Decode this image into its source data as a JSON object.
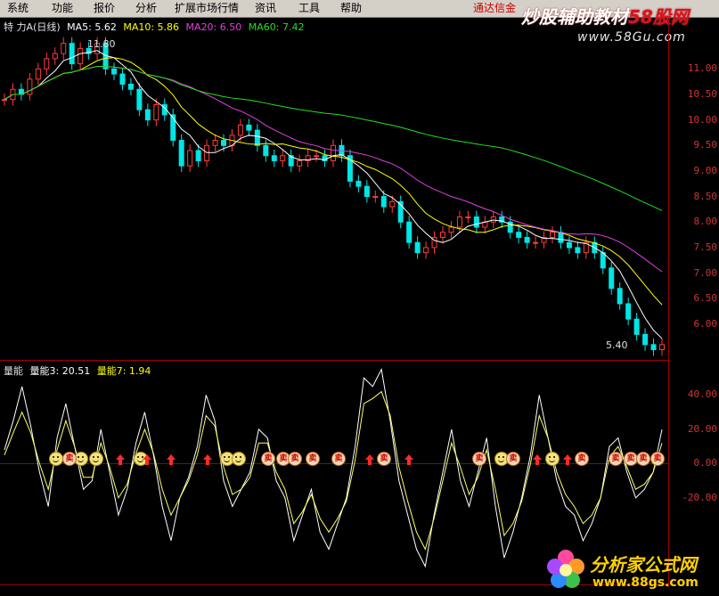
{
  "menu": {
    "items": [
      "系统",
      "功能",
      "报价",
      "分析",
      "扩展市场行情",
      "资讯",
      "工具",
      "帮助"
    ],
    "broker": "通达信金"
  },
  "watermark": {
    "brand_white": "炒股辅助教材",
    "brand_red": "58股网",
    "url": "www.58Gu.com",
    "bottom_title": "分析家公式网",
    "bottom_url": "www.88gs.com"
  },
  "price_panel": {
    "title": "特 力A(日线)",
    "ma5_label": "MA5: 5.62",
    "ma10_label": "MA10: 5.86",
    "ma20_label": "MA20: 6.50",
    "ma60_label": "MA60: 7.42",
    "high_note": "11.80",
    "low_note": "5.40",
    "ticks": [
      "11.00",
      "10.50",
      "10.00",
      "9.50",
      "9.00",
      "8.50",
      "8.00",
      "7.50",
      "7.00",
      "6.50",
      "6.00"
    ]
  },
  "volume_panel": {
    "title": "量能",
    "l1": "量能3: 20.51",
    "l2": "量能7: 1.94",
    "ticks": [
      "40.00",
      "20.00",
      "0.00",
      "-20.00"
    ]
  },
  "colors": {
    "ma5": "#ffffff",
    "ma10": "#ffff00",
    "ma20": "#e040e0",
    "ma60": "#20e020",
    "up": "#ff3c3c",
    "down": "#00e5e5",
    "axis": "#d23434"
  },
  "chart_data": {
    "type": "candlestick",
    "title": "特 力A(日线)",
    "ylim": [
      5.3,
      12.0
    ],
    "closes": [
      10.4,
      10.6,
      10.5,
      10.8,
      11.0,
      11.2,
      11.3,
      11.5,
      11.1,
      11.4,
      11.3,
      11.5,
      11.0,
      10.9,
      10.7,
      10.6,
      10.2,
      10.0,
      10.3,
      10.1,
      9.6,
      9.1,
      9.4,
      9.2,
      9.5,
      9.6,
      9.5,
      9.7,
      9.9,
      9.8,
      9.5,
      9.3,
      9.2,
      9.3,
      9.1,
      9.2,
      9.3,
      9.3,
      9.2,
      9.5,
      9.3,
      8.8,
      8.7,
      8.5,
      8.5,
      8.3,
      8.4,
      8.0,
      7.6,
      7.4,
      7.5,
      7.7,
      7.8,
      7.9,
      8.1,
      8.1,
      7.9,
      8.0,
      8.1,
      8.0,
      7.8,
      7.7,
      7.6,
      7.6,
      7.7,
      7.8,
      7.6,
      7.5,
      7.4,
      7.6,
      7.4,
      7.1,
      6.7,
      6.4,
      6.1,
      5.8,
      5.6,
      5.5,
      5.6
    ],
    "volume_s1": [
      8,
      25,
      45,
      22,
      -5,
      -25,
      15,
      35,
      10,
      -15,
      -10,
      20,
      -5,
      -30,
      -15,
      12,
      30,
      5,
      -25,
      -45,
      -20,
      -8,
      10,
      40,
      25,
      -10,
      -25,
      -15,
      -5,
      20,
      15,
      -10,
      -20,
      -45,
      -30,
      -15,
      -40,
      -50,
      -35,
      -20,
      10,
      50,
      45,
      55,
      25,
      -10,
      -30,
      -50,
      -60,
      -30,
      -5,
      20,
      -10,
      -25,
      -5,
      15,
      -25,
      -55,
      -40,
      -20,
      5,
      40,
      15,
      -10,
      -25,
      -30,
      -45,
      -35,
      -20,
      10,
      15,
      -5,
      -20,
      -15,
      -5,
      20
    ],
    "volume_s2": [
      5,
      18,
      30,
      18,
      0,
      -15,
      8,
      25,
      10,
      -8,
      -8,
      12,
      -2,
      -20,
      -12,
      6,
      20,
      6,
      -15,
      -30,
      -20,
      -10,
      5,
      28,
      22,
      -2,
      -18,
      -15,
      -8,
      12,
      12,
      -5,
      -15,
      -35,
      -28,
      -18,
      -32,
      -40,
      -32,
      -22,
      2,
      35,
      38,
      42,
      28,
      -2,
      -22,
      -40,
      -50,
      -32,
      -10,
      12,
      -2,
      -18,
      -8,
      8,
      -15,
      -42,
      -35,
      -22,
      0,
      28,
      15,
      -5,
      -18,
      -25,
      -35,
      -30,
      -20,
      4,
      10,
      -2,
      -15,
      -12,
      -5,
      12
    ]
  }
}
